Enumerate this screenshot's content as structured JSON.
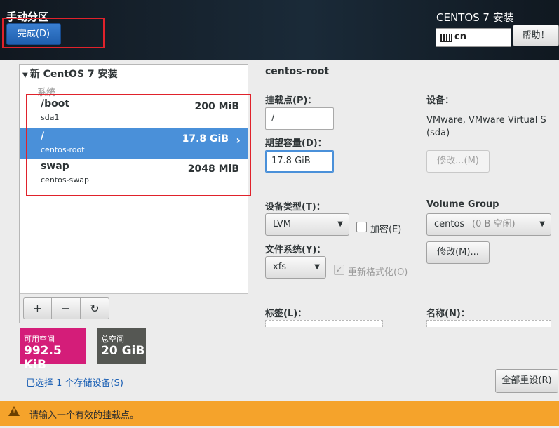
{
  "header": {
    "spoke_title": "手动分区",
    "done_label": "完成(D)",
    "product_title": "CENTOS 7 安装",
    "keyboard_layout": "cn",
    "help_label": "帮助！"
  },
  "left_panel": {
    "tree_title": "新 CentOS 7 安装",
    "group_label": "系统",
    "mount_points": [
      {
        "name": "/boot",
        "device": "sda1",
        "size": "200 MiB",
        "selected": false
      },
      {
        "name": "/",
        "device": "centos-root",
        "size": "17.8 GiB",
        "selected": true
      },
      {
        "name": "swap",
        "device": "centos-swap",
        "size": "2048 MiB",
        "selected": false
      }
    ],
    "toolbar": {
      "add": "+",
      "remove": "−",
      "refresh": "↻"
    }
  },
  "space": {
    "available_label": "可用空间",
    "available_value": "992.5 KiB",
    "total_label": "总空间",
    "total_value": "20 GiB"
  },
  "storage_link": "已选择 1 个存储设备(S)",
  "detail": {
    "title": "centos-root",
    "mount_point_label": "挂载点(P)：",
    "mount_point_value": "/",
    "capacity_label": "期望容量(D)：",
    "capacity_value": "17.8 GiB",
    "device_label": "设备：",
    "device_value_line1": "VMware, VMware Virtual S",
    "device_value_line2": "(sda)",
    "modify_device_label": "修改...(M)",
    "device_type_label": "设备类型(T)：",
    "device_type_value": "LVM",
    "encrypt_label": "加密(E)",
    "filesystem_label": "文件系统(Y)：",
    "filesystem_value": "xfs",
    "reformat_label": "重新格式化(O)",
    "volume_group_label": "Volume Group",
    "volume_group_value": "centos",
    "volume_group_free": "(0 B 空闲)",
    "modify_vg_label": "修改(M)...",
    "tag_label": "标签(L)：",
    "name_label": "名称(N)：",
    "reset_all_label": "全部重设(R)"
  },
  "warning": {
    "text": "请输入一个有效的挂载点。"
  },
  "colors": {
    "accent": "#4a90d9",
    "available": "#d41d79",
    "total": "#555753",
    "warning": "#f5a32b",
    "highlight": "#e0222b"
  }
}
